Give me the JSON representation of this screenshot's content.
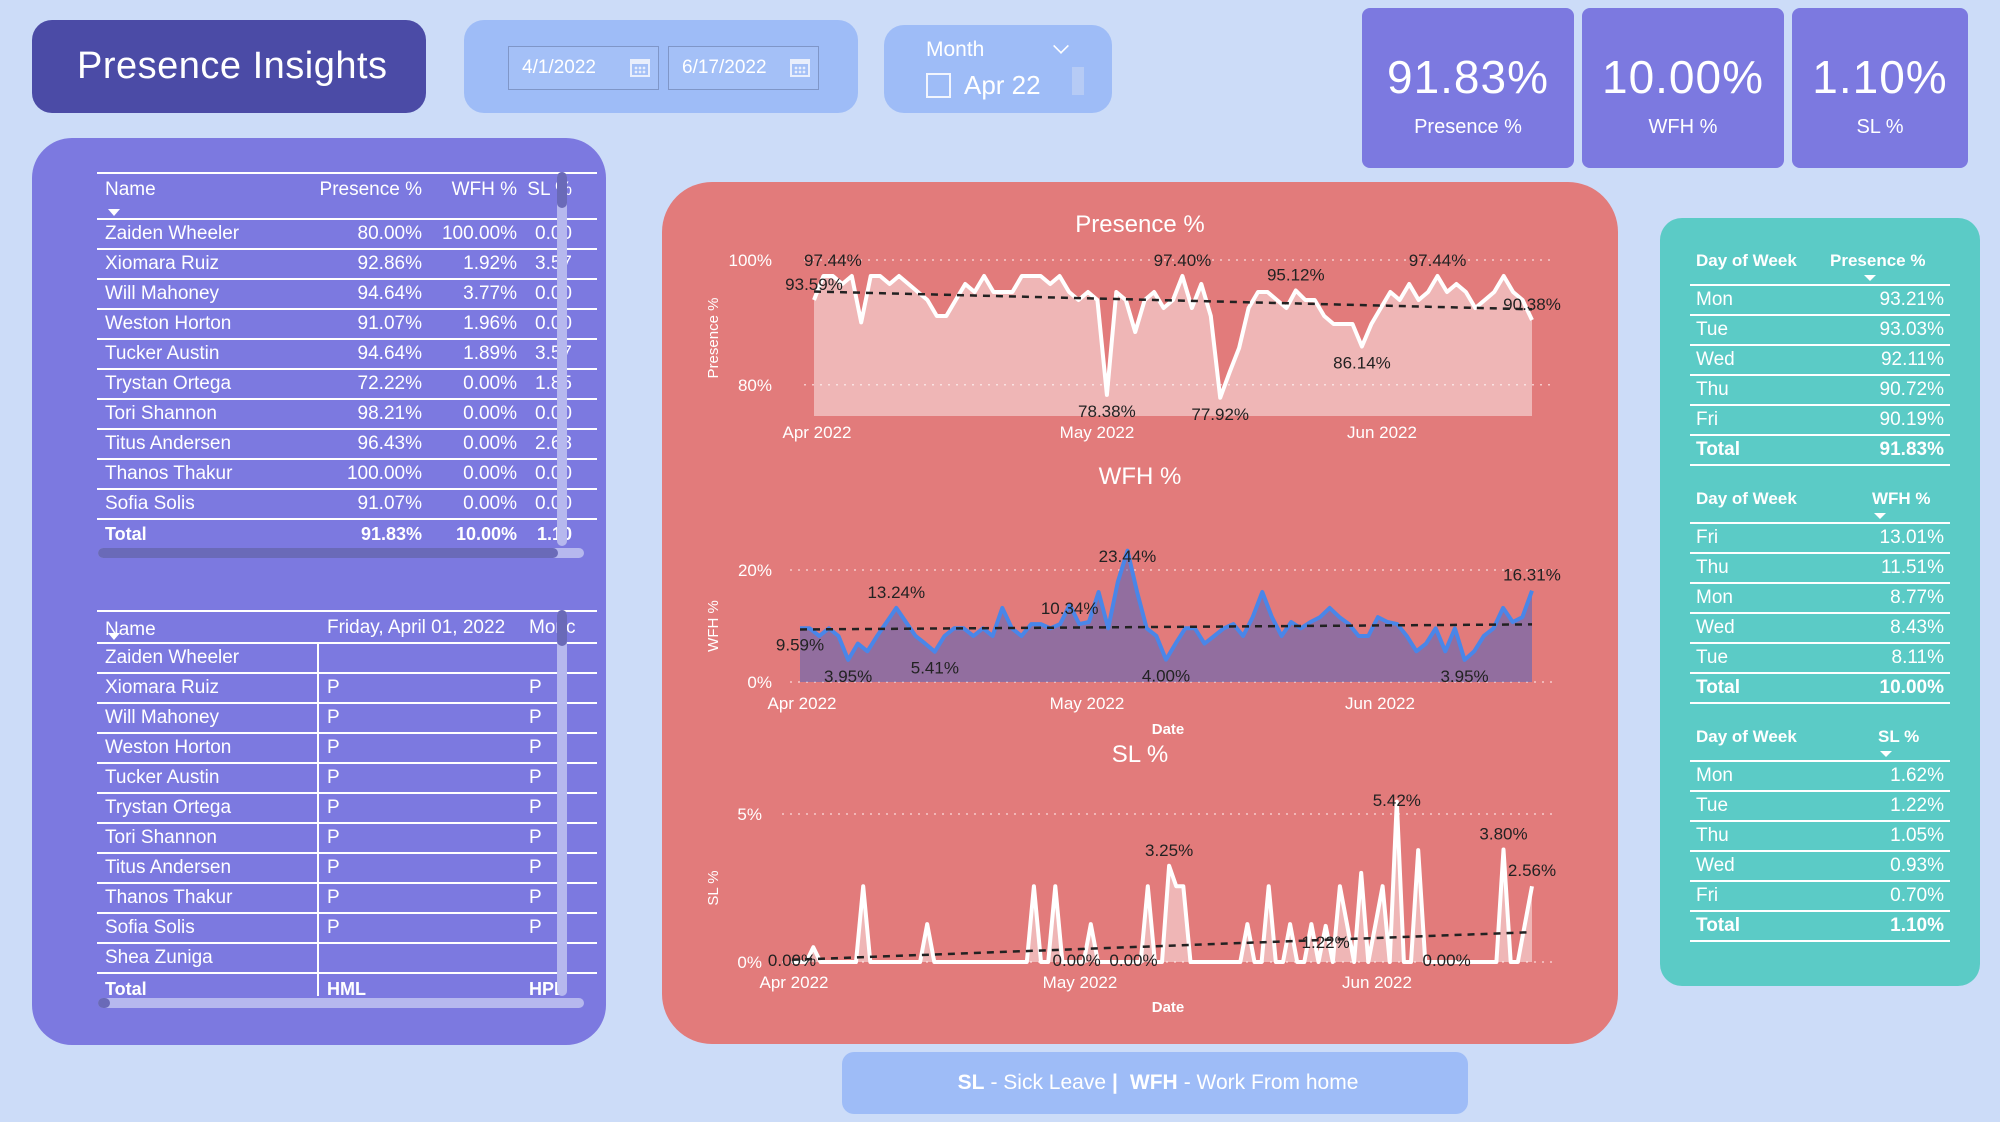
{
  "title": "Presence Insights",
  "date_range": {
    "start": "4/1/2022",
    "end": "6/17/2022"
  },
  "month_slicer": {
    "label": "Month",
    "value": "Apr 22"
  },
  "kpis": [
    {
      "value": "91.83%",
      "label": "Presence %"
    },
    {
      "value": "10.00%",
      "label": "WFH %"
    },
    {
      "value": "1.10%",
      "label": "SL %"
    }
  ],
  "employee_table": {
    "headers": [
      "Name",
      "Presence %",
      "WFH %",
      "SL %"
    ],
    "rows": [
      [
        "Zaiden Wheeler",
        "80.00%",
        "100.00%",
        "0.00"
      ],
      [
        "Xiomara Ruiz",
        "92.86%",
        "1.92%",
        "3.57"
      ],
      [
        "Will Mahoney",
        "94.64%",
        "3.77%",
        "0.00"
      ],
      [
        "Weston Horton",
        "91.07%",
        "1.96%",
        "0.00"
      ],
      [
        "Tucker Austin",
        "94.64%",
        "1.89%",
        "3.57"
      ],
      [
        "Trystan Ortega",
        "72.22%",
        "0.00%",
        "1.85"
      ],
      [
        "Tori Shannon",
        "98.21%",
        "0.00%",
        "0.00"
      ],
      [
        "Titus Andersen",
        "96.43%",
        "0.00%",
        "2.68"
      ],
      [
        "Thanos Thakur",
        "100.00%",
        "0.00%",
        "0.00"
      ],
      [
        "Sofia Solis",
        "91.07%",
        "0.00%",
        "0.00"
      ]
    ],
    "total": [
      "Total",
      "91.83%",
      "10.00%",
      "1.10"
    ]
  },
  "attendance_table": {
    "headers": [
      "Name",
      "Friday, April 01, 2022",
      "Monc"
    ],
    "rows": [
      [
        "Zaiden Wheeler",
        "",
        ""
      ],
      [
        "Xiomara Ruiz",
        "P",
        "P"
      ],
      [
        "Will Mahoney",
        "P",
        "P"
      ],
      [
        "Weston Horton",
        "P",
        "P"
      ],
      [
        "Tucker Austin",
        "P",
        "P"
      ],
      [
        "Trystan Ortega",
        "P",
        "P"
      ],
      [
        "Tori Shannon",
        "P",
        "P"
      ],
      [
        "Titus Andersen",
        "P",
        "P"
      ],
      [
        "Thanos Thakur",
        "P",
        "P"
      ],
      [
        "Sofia Solis",
        "P",
        "P"
      ],
      [
        "Shea Zuniga",
        "",
        ""
      ]
    ],
    "total": [
      "Total",
      "HML",
      "HPL"
    ]
  },
  "chart_data": [
    {
      "type": "area",
      "title": "Presence %",
      "xlabel": "",
      "ylabel": "Presence %",
      "x_ticks": [
        "Apr 2022",
        "May 2022",
        "Jun 2022"
      ],
      "y_ticks": [
        "100%",
        "80%"
      ],
      "ylim": [
        0.75,
        1.0
      ],
      "trendline": true,
      "values": [
        0.9359,
        0.9744,
        0.9744,
        0.9615,
        0.9744,
        0.9,
        0.9744,
        0.9744,
        0.9615,
        0.9744,
        0.9615,
        0.9487,
        0.9359,
        0.9103,
        0.9103,
        0.9359,
        0.9615,
        0.9487,
        0.9744,
        0.9487,
        0.9487,
        0.9487,
        0.9744,
        0.9744,
        0.9744,
        0.9615,
        0.9744,
        0.9487,
        0.9359,
        0.9487,
        0.9359,
        0.7838,
        0.9487,
        0.9359,
        0.8846,
        0.9359,
        0.9487,
        0.9231,
        0.9359,
        0.9744,
        0.9231,
        0.9615,
        0.9103,
        0.7792,
        0.8205,
        0.859,
        0.9231,
        0.9487,
        0.9487,
        0.9359,
        0.9231,
        0.9512,
        0.9359,
        0.9359,
        0.9103,
        0.8974,
        0.8974,
        0.8974,
        0.8614,
        0.8974,
        0.9231,
        0.9487,
        0.9359,
        0.9615,
        0.9359,
        0.9487,
        0.9744,
        0.9487,
        0.9615,
        0.9487,
        0.9231,
        0.9359,
        0.9487,
        0.9744,
        0.9487,
        0.9359,
        0.9038
      ],
      "labels": [
        {
          "text": "97.44%",
          "index": 2,
          "value": 0.9744
        },
        {
          "text": "93.59%",
          "index": 0,
          "value": 0.9359
        },
        {
          "text": "78.38%",
          "index": 31,
          "value": 0.7838
        },
        {
          "text": "97.40%",
          "index": 39,
          "value": 0.9744
        },
        {
          "text": "77.92%",
          "index": 43,
          "value": 0.7792
        },
        {
          "text": "95.12%",
          "index": 51,
          "value": 0.9512
        },
        {
          "text": "86.14%",
          "index": 58,
          "value": 0.8614
        },
        {
          "text": "97.44%",
          "index": 66,
          "value": 0.9744
        },
        {
          "text": "90.38%",
          "index": 76,
          "value": 0.9038
        }
      ]
    },
    {
      "type": "area",
      "title": "WFH %",
      "xlabel": "Date",
      "ylabel": "WFH %",
      "x_ticks": [
        "Apr 2022",
        "May 2022",
        "Jun 2022"
      ],
      "y_ticks": [
        "20%",
        "0%"
      ],
      "ylim": [
        0,
        0.2
      ],
      "trendline": true,
      "values": [
        0.0959,
        0.0959,
        0.0822,
        0.0959,
        0.0822,
        0.0395,
        0.0685,
        0.0548,
        0.0822,
        0.1071,
        0.1324,
        0.1071,
        0.0822,
        0.0685,
        0.0541,
        0.0822,
        0.0959,
        0.0959,
        0.0822,
        0.0959,
        0.0822,
        0.1324,
        0.0959,
        0.0822,
        0.1034,
        0.1034,
        0.0959,
        0.1034,
        0.1378,
        0.1034,
        0.1071,
        0.1607,
        0.0959,
        0.1786,
        0.2344,
        0.1607,
        0.0959,
        0.0822,
        0.04,
        0.0685,
        0.0959,
        0.0959,
        0.0685,
        0.0822,
        0.0959,
        0.1034,
        0.0822,
        0.1159,
        0.1607,
        0.1159,
        0.0822,
        0.1071,
        0.0959,
        0.1071,
        0.1159,
        0.1323,
        0.1159,
        0.1034,
        0.0822,
        0.0822,
        0.1159,
        0.1071,
        0.1034,
        0.0822,
        0.0548,
        0.0685,
        0.0959,
        0.0548,
        0.0959,
        0.0395,
        0.0548,
        0.0822,
        0.0959,
        0.1324,
        0.1071,
        0.1159,
        0.1631
      ],
      "labels": [
        {
          "text": "9.59%",
          "index": 0,
          "value": 0.0959
        },
        {
          "text": "3.95%",
          "index": 5,
          "value": 0.0395
        },
        {
          "text": "13.24%",
          "index": 10,
          "value": 0.1324
        },
        {
          "text": "5.41%",
          "index": 14,
          "value": 0.0541
        },
        {
          "text": "23.44%",
          "index": 34,
          "value": 0.2344
        },
        {
          "text": "10.34%",
          "index": 28,
          "value": 0.1034
        },
        {
          "text": "4.00%",
          "index": 38,
          "value": 0.04
        },
        {
          "text": "3.95%",
          "index": 69,
          "value": 0.0395
        },
        {
          "text": "16.31%",
          "index": 76,
          "value": 0.1631
        }
      ]
    },
    {
      "type": "area",
      "title": "SL %",
      "xlabel": "Date",
      "ylabel": "SL %",
      "x_ticks": [
        "Apr 2022",
        "May 2022",
        "Jun 2022"
      ],
      "y_ticks": [
        "5%",
        "0%"
      ],
      "ylim": [
        0,
        0.05
      ],
      "trendline": true,
      "values": [
        0.0,
        0.0,
        0.0,
        0.0,
        0.0,
        0.0,
        0.0,
        0.0,
        0.0,
        0.0,
        0.0,
        0.0,
        0.0,
        0.0,
        0.0,
        0.0,
        0.0,
        0.0,
        0.0,
        0.0,
        0.0,
        0.0,
        0.0,
        0.0,
        0.0,
        0.0,
        0.0,
        0.0,
        0.0,
        0.0,
        0.0,
        0.0,
        0.0,
        0.0,
        0.0,
        0.0,
        0.0,
        0.0,
        0.0,
        0.0,
        0.0,
        0.0,
        0.0,
        0.0,
        0.0,
        0.0,
        0.0,
        0.0,
        0.0,
        0.0,
        0.0,
        0.0,
        0.0,
        0.0,
        0.0,
        0.0,
        0.0,
        0.0,
        0.0,
        0.0,
        0.0,
        0.0,
        0.0,
        0.0,
        0.0,
        0.0,
        0.0,
        0.0,
        0.0,
        0.0,
        0.0,
        0.0,
        0.0,
        0.0,
        0.0,
        0.0,
        0.0
      ],
      "sl_values": [
        0.0,
        0.0,
        0.0,
        0.005,
        0.0,
        0.0,
        0.0,
        0.0,
        0.0,
        0.0,
        0.0256,
        0.0,
        0.0,
        0.0,
        0.0,
        0.0,
        0.0,
        0.0,
        0.0,
        0.0128,
        0.0,
        0.0,
        0.0,
        0.0,
        0.0,
        0.0,
        0.0,
        0.0,
        0.0,
        0.0,
        0.0,
        0.0,
        0.0,
        0.0,
        0.0256,
        0.0,
        0.0,
        0.0256,
        0.0,
        0.0,
        0.0,
        0.0,
        0.0128,
        0.0,
        0.0,
        0.0,
        0.0,
        0.0,
        0.0,
        0.0,
        0.0256,
        0.0,
        0.0,
        0.0325,
        0.0256,
        0.0256,
        0.0,
        0.0,
        0.0,
        0.0,
        0.0,
        0.0,
        0.0,
        0.0,
        0.0128,
        0.0,
        0.0,
        0.0256,
        0.0,
        0.0,
        0.0128,
        0.0,
        0.0,
        0.0128,
        0.0,
        0.0122,
        0.0,
        0.0256,
        0.0128,
        0.0,
        0.0301,
        0.0,
        0.0128,
        0.0256,
        0.0,
        0.0542,
        0.0,
        0.0,
        0.0378,
        0.0,
        0.0,
        0.0,
        0.0,
        0.0,
        0.0,
        0.0,
        0.0,
        0.0,
        0.0,
        0.0,
        0.038,
        0.0,
        0.0,
        0.0128,
        0.0256
      ],
      "labels": [
        {
          "text": "0.00%",
          "index": 0,
          "value": 0.0
        },
        {
          "text": "3.25%",
          "index": 53,
          "value": 0.0325
        },
        {
          "text": "0.00%",
          "index": 40,
          "value": 0.0
        },
        {
          "text": "0.00%",
          "index": 48,
          "value": 0.0
        },
        {
          "text": "5.42%",
          "index": 85,
          "value": 0.0542
        },
        {
          "text": "1.22%",
          "index": 75,
          "value": 0.0122
        },
        {
          "text": "0.00%",
          "index": 92,
          "value": 0.0
        },
        {
          "text": "3.80%",
          "index": 100,
          "value": 0.038
        },
        {
          "text": "2.56%",
          "index": 104,
          "value": 0.0256
        }
      ]
    }
  ],
  "day_of_week": {
    "presence": {
      "headers": [
        "Day of Week",
        "Presence %"
      ],
      "rows": [
        [
          "Mon",
          "93.21%"
        ],
        [
          "Tue",
          "93.03%"
        ],
        [
          "Wed",
          "92.11%"
        ],
        [
          "Thu",
          "90.72%"
        ],
        [
          "Fri",
          "90.19%"
        ]
      ],
      "total": [
        "Total",
        "91.83%"
      ]
    },
    "wfh": {
      "headers": [
        "Day of Week",
        "WFH %"
      ],
      "rows": [
        [
          "Fri",
          "13.01%"
        ],
        [
          "Thu",
          "11.51%"
        ],
        [
          "Mon",
          "8.77%"
        ],
        [
          "Wed",
          "8.43%"
        ],
        [
          "Tue",
          "8.11%"
        ]
      ],
      "total": [
        "Total",
        "10.00%"
      ]
    },
    "sl": {
      "headers": [
        "Day of Week",
        "SL %"
      ],
      "rows": [
        [
          "Mon",
          "1.62%"
        ],
        [
          "Tue",
          "1.22%"
        ],
        [
          "Thu",
          "1.05%"
        ],
        [
          "Wed",
          "0.93%"
        ],
        [
          "Fri",
          "0.70%"
        ]
      ],
      "total": [
        "Total",
        "1.10%"
      ]
    }
  },
  "legend": {
    "sl_key": "SL",
    "sl_text": " - Sick Leave ",
    "sep": "|",
    "wfh_key": "WFH",
    "wfh_text": " - Work From home"
  },
  "colors": {
    "background": "#ccdcf8",
    "title_bg": "#4b4ba6",
    "panel_purple": "#7c79e0",
    "panel_red": "#e27b7b",
    "panel_teal": "#5bcbc6",
    "slicer_bg": "#9ebcf7",
    "wfh_line": "#4a86e8",
    "presence_line": "#ffffff"
  }
}
